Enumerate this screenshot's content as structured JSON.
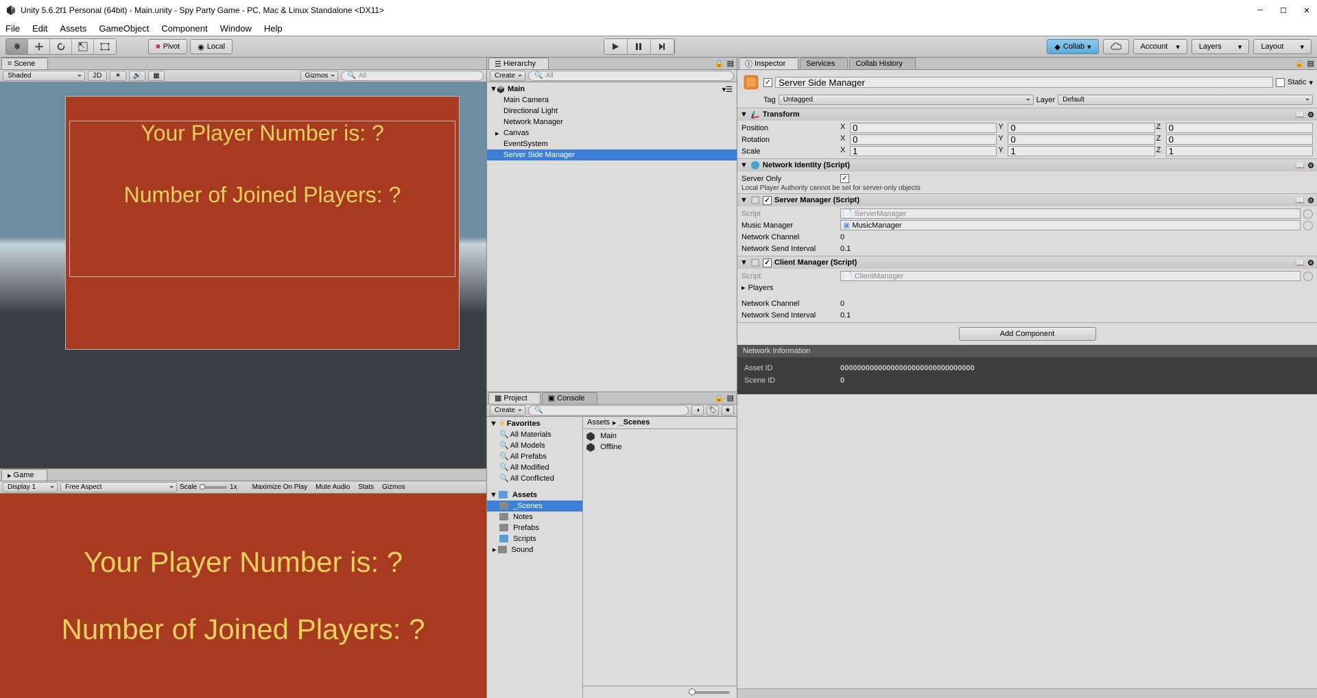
{
  "window": {
    "title": "Unity 5.6.2f1 Personal (64bit) - Main.unity - Spy Party Game - PC, Mac & Linux Standalone <DX11>"
  },
  "menubar": [
    "File",
    "Edit",
    "Assets",
    "GameObject",
    "Component",
    "Window",
    "Help"
  ],
  "toolbar": {
    "pivot": "Pivot",
    "local": "Local",
    "collab": "Collab",
    "account": "Account",
    "layers": "Layers",
    "layout": "Layout"
  },
  "scene": {
    "tab": "Scene",
    "shading": "Shaded",
    "mode2d": "2D",
    "gizmos": "Gizmos",
    "search_placeholder": "All",
    "text1": "Your Player Number is: ?",
    "text2": "Number of Joined Players: ?"
  },
  "game": {
    "tab": "Game",
    "display": "Display 1",
    "aspect": "Free Aspect",
    "scale_label": "Scale",
    "scale_value": "1x",
    "maximize": "Maximize On Play",
    "mute": "Mute Audio",
    "stats": "Stats",
    "gizmos": "Gizmos",
    "text1": "Your Player Number is: ?",
    "text2": "Number of Joined Players: ?"
  },
  "hierarchy": {
    "tab": "Hierarchy",
    "create": "Create",
    "search_placeholder": "All",
    "scene_name": "Main",
    "items": [
      "Main Camera",
      "Directional Light",
      "Network Manager",
      "Canvas",
      "EventSystem",
      "Server Side Manager"
    ]
  },
  "project": {
    "tab": "Project",
    "console_tab": "Console",
    "create": "Create",
    "favorites": "Favorites",
    "fav_items": [
      "All Materials",
      "All Models",
      "All Prefabs",
      "All Modified",
      "All Conflicted"
    ],
    "assets": "Assets",
    "asset_items": [
      "_Scenes",
      "Notes",
      "Prefabs",
      "Scripts",
      "Sound"
    ],
    "breadcrumb": [
      "Assets",
      "_Scenes"
    ],
    "content_items": [
      "Main",
      "Offline"
    ]
  },
  "inspector": {
    "tab": "Inspector",
    "services_tab": "Services",
    "collab_history_tab": "Collab History",
    "object_name": "Server Side Manager",
    "static": "Static",
    "tag_label": "Tag",
    "tag_value": "Untagged",
    "layer_label": "Layer",
    "layer_value": "Default",
    "transform": {
      "title": "Transform",
      "position": "Position",
      "rotation": "Rotation",
      "scale": "Scale",
      "pos": {
        "x": "0",
        "y": "0",
        "z": "0"
      },
      "rot": {
        "x": "0",
        "y": "0",
        "z": "0"
      },
      "scl": {
        "x": "1",
        "y": "1",
        "z": "1"
      }
    },
    "network_identity": {
      "title": "Network Identity (Script)",
      "server_only": "Server Only",
      "warning": "Local Player Authority cannot be set for server-only objects"
    },
    "server_manager": {
      "title": "Server Manager (Script)",
      "script_label": "Script",
      "script_value": "ServerManager",
      "music_label": "Music Manager",
      "music_value": "MusicManager",
      "channel_label": "Network Channel",
      "channel_value": "0",
      "interval_label": "Network Send Interval",
      "interval_value": "0.1"
    },
    "client_manager": {
      "title": "Client Manager (Script)",
      "script_label": "Script",
      "script_value": "ClientManager",
      "players_label": "Players",
      "channel_label": "Network Channel",
      "channel_value": "0",
      "interval_label": "Network Send Interval",
      "interval_value": "0.1"
    },
    "add_component": "Add Component",
    "network_info": {
      "title": "Network Information",
      "asset_id_label": "Asset ID",
      "asset_id_value": "00000000000000000000000000000000",
      "scene_id_label": "Scene ID",
      "scene_id_value": "0"
    }
  }
}
